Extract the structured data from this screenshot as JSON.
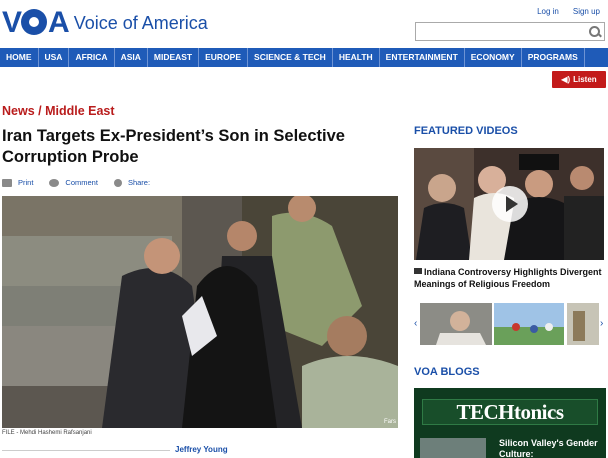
{
  "header": {
    "logo_letters": "VOA",
    "logo_text": "Voice of America",
    "login": "Log in",
    "signup": "Sign up",
    "search_placeholder": ""
  },
  "nav": {
    "items": [
      "HOME",
      "USA",
      "AFRICA",
      "ASIA",
      "MIDEAST",
      "EUROPE",
      "SCIENCE & TECH",
      "HEALTH",
      "ENTERTAINMENT",
      "ECONOMY",
      "PROGRAMS"
    ]
  },
  "listen": {
    "label": "Listen",
    "icon": "speaker-icon"
  },
  "article": {
    "section": "News / Middle East",
    "headline": "Iran Targets Ex-President’s Son in Selective Corruption Probe",
    "tools": {
      "print": "Print",
      "comment": "Comment",
      "share": "Share:"
    },
    "photo_credit": "FILE - Mehdi Hashemi Rafsanjani",
    "photo_watermark": "Fars",
    "byline": "Jeffrey Young"
  },
  "sidebar": {
    "featured_heading": "FEATURED VIDEOS",
    "video_title": "Indiana Controversy Highlights Divergent Meanings of Religious Freedom",
    "blogs_heading": "VOA BLOGS",
    "blog_name": "TECHtonics",
    "blog_teaser": "Silicon Valley's Gender Culture:"
  },
  "colors": {
    "brand_blue": "#1a4fa8",
    "nav_blue": "#1f5bb8",
    "section_red": "#b91c1c",
    "listen_red": "#c31a1a"
  }
}
